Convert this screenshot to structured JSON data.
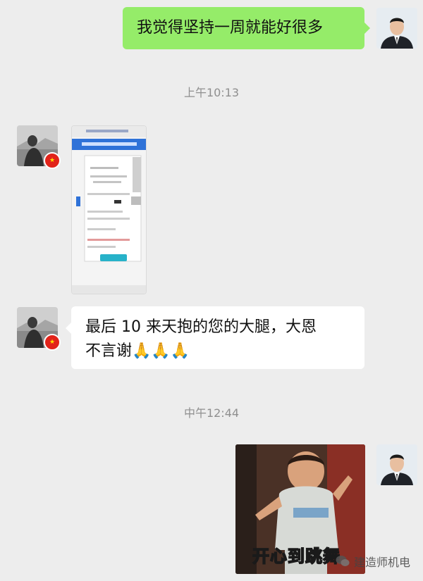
{
  "messages": [
    {
      "sender": "me",
      "type": "text",
      "text": "我觉得坚持一周就能好很多"
    },
    {
      "type": "timestamp",
      "text": "上午10:13"
    },
    {
      "sender": "other",
      "type": "image"
    },
    {
      "sender": "other",
      "type": "text",
      "line1": "最后 10 来天抱的您的大腿，大恩",
      "line2": "不言谢",
      "emoji": "🙏🙏🙏"
    },
    {
      "type": "timestamp",
      "text": "中午12:44"
    },
    {
      "sender": "me",
      "type": "gif",
      "caption": "开心到跳舞"
    }
  ],
  "watermark": {
    "text": "建造师机电"
  },
  "colors": {
    "background": "#ededed",
    "me_bubble": "#95ec69",
    "other_bubble": "#ffffff",
    "timestamp": "#8f8f8f"
  }
}
